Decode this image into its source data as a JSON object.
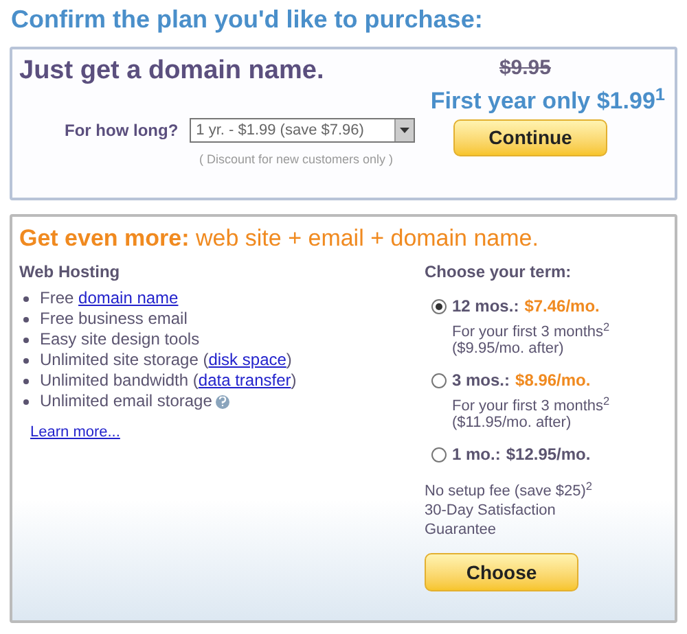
{
  "page_title": "Confirm the plan you'd like to purchase:",
  "domain_plan": {
    "title": "Just get a domain name.",
    "old_price": "$9.95",
    "offer": "First year only $1.99$^{1}$",
    "duration_label": "For how long?",
    "duration_value": "1 yr. - $1.99 (save $7.96)",
    "discount_note": "( Discount for new customers only )",
    "button": "Continue"
  },
  "hosting_plan": {
    "title_bold": "Get even more:",
    "title_rest": "web site + email + domain name.",
    "features_heading": "Web Hosting",
    "features": [
      {
        "text": "Free ",
        "link": "domain name",
        "help": false
      },
      {
        "text": "Free business email",
        "help": false
      },
      {
        "text": "Easy site design tools",
        "help": false
      },
      {
        "text": "Unlimited site storage (",
        "link": "disk space",
        "after": ")",
        "help": false
      },
      {
        "text": "Unlimited bandwidth (",
        "link": "data transfer",
        "after": ")",
        "help": false
      },
      {
        "text": "Unlimited email storage",
        "help": true
      }
    ],
    "learn_more": "Learn more...",
    "term_heading": "Choose your term:",
    "terms": [
      {
        "label": "12 mos.:",
        "price": "$7.46/mo.",
        "highlight": true,
        "note": "For your first 3 months$^{2}$",
        "note_after": "($9.95/mo. after)",
        "selected": true
      },
      {
        "label": "3 mos.:",
        "price": "$8.96/mo.",
        "highlight": true,
        "note": "For your first 3 months$^{2}$",
        "note_after": "($11.95/mo. after)",
        "selected": false
      },
      {
        "label": "1 mo.:",
        "price": "$12.95/mo.",
        "highlight": false,
        "selected": false
      }
    ],
    "setup_note": "No setup fee (save $25)$^{2}$",
    "guarantee": "30-Day Satisfaction Guarantee",
    "button": "Choose"
  }
}
